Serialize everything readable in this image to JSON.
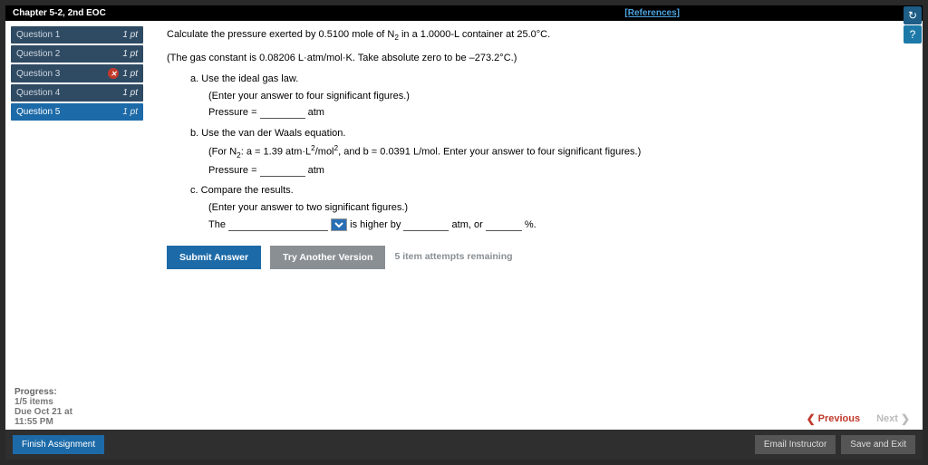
{
  "header": {
    "chapter": "Chapter 5-2, 2nd EOC",
    "references": "[References]"
  },
  "sidebar": {
    "items": [
      {
        "label": "Question 1",
        "pts": "1 pt",
        "active": false,
        "wrong": false
      },
      {
        "label": "Question 2",
        "pts": "1 pt",
        "active": false,
        "wrong": false
      },
      {
        "label": "Question 3",
        "pts": "1 pt",
        "active": false,
        "wrong": true
      },
      {
        "label": "Question 4",
        "pts": "1 pt",
        "active": false,
        "wrong": false
      },
      {
        "label": "Question 5",
        "pts": "1 pt",
        "active": true,
        "wrong": false
      }
    ]
  },
  "question": {
    "intro_pre": "Calculate the pressure exerted by 0.5100 mole of N",
    "intro_post": " in a 1.0000-L container at 25.0°C.",
    "constant": "(The gas constant is 0.08206 L·atm/mol·K. Take absolute zero to be –273.2°C.)",
    "a_label": "a.",
    "a_text": "Use the ideal gas law.",
    "a_hint": "(Enter your answer to four significant figures.)",
    "pressure_label": "Pressure =",
    "atm": "atm",
    "b_label": "b.",
    "b_text": "Use the van der Waals equation.",
    "b_hint_pre": "(For N",
    "b_hint_mid1": ": a = 1.39 atm·L",
    "b_hint_mid2": "/mol",
    "b_hint_post": ", and b = 0.0391 L/mol. Enter your answer to four significant figures.)",
    "c_label": "c.",
    "c_text": "Compare the results.",
    "c_hint": "(Enter your answer to two significant figures.)",
    "c_sentence_1": "The",
    "c_sentence_2": "is higher by",
    "c_sentence_3": "atm, or",
    "c_sentence_4": "%."
  },
  "buttons": {
    "submit": "Submit Answer",
    "try": "Try Another Version",
    "attempts": "5 item attempts remaining"
  },
  "progress": {
    "label": "Progress:",
    "value": "1/5 items",
    "due1": "Due Oct 21 at",
    "due2": "11:55 PM"
  },
  "nav": {
    "previous": "Previous",
    "next": "Next"
  },
  "footer": {
    "finish": "Finish Assignment",
    "email": "Email Instructor",
    "save": "Save and Exit"
  }
}
